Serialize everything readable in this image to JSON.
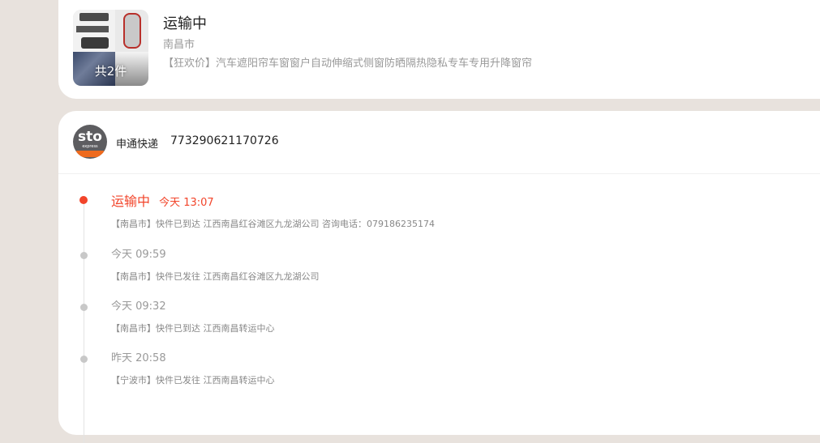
{
  "order": {
    "status": "运输中",
    "city": "南昌市",
    "product": "【狂欢价】汽车遮阳帘车窗窗户自动伸缩式侧窗防晒隔热隐私专车专用升降窗帘",
    "item_count": "共2件"
  },
  "shipment": {
    "carrier": "申通快递",
    "tracking_number": "773290621170726",
    "logo_text": "sto",
    "logo_subtext": "express"
  },
  "events": [
    {
      "status": "运输中",
      "time": "今天 13:07",
      "desc": "【南昌市】快件已到达 江西南昌红谷滩区九龙湖公司 咨询电话：079186235174",
      "active": true
    },
    {
      "status": "",
      "time": "今天 09:59",
      "desc": "【南昌市】快件已发往 江西南昌红谷滩区九龙湖公司",
      "active": false
    },
    {
      "status": "",
      "time": "今天 09:32",
      "desc": "【南昌市】快件已到达 江西南昌转运中心",
      "active": false
    },
    {
      "status": "",
      "time": "昨天 20:58",
      "desc": "【宁波市】快件已发往 江西南昌转运中心",
      "active": false
    }
  ],
  "colors": {
    "accent": "#f2442a",
    "background": "#e8e2dd"
  }
}
